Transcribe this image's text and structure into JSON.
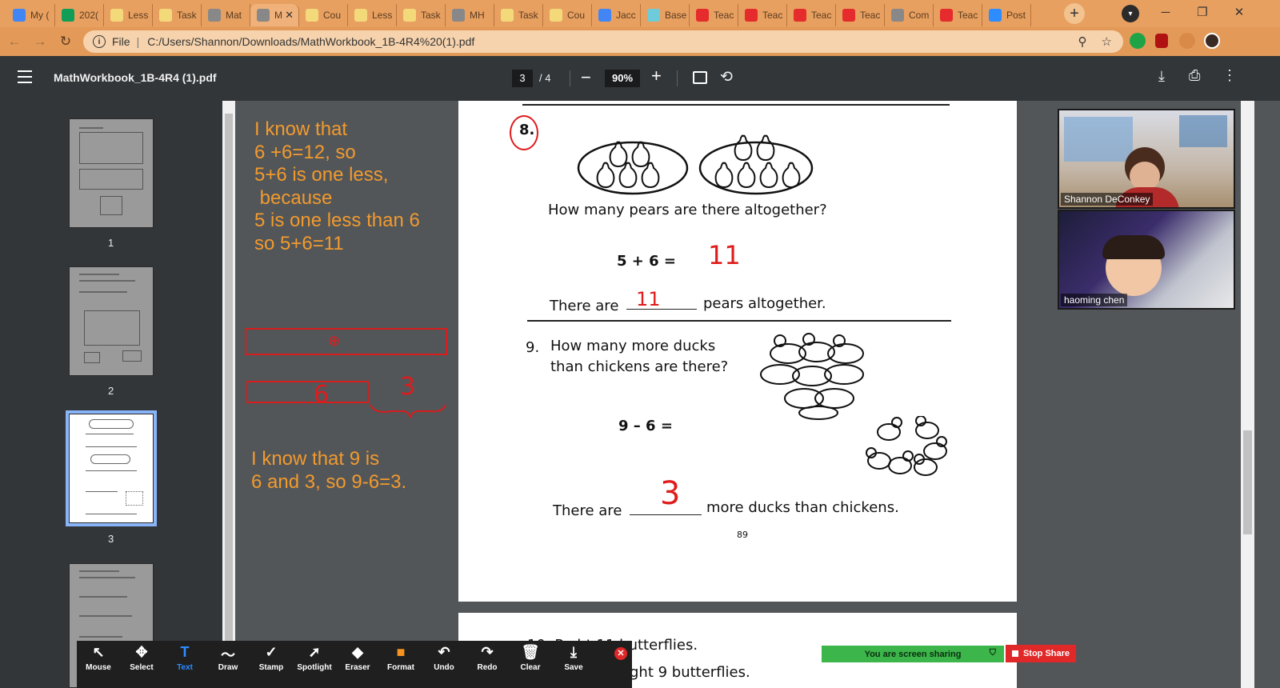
{
  "browser": {
    "tabs": [
      {
        "label": "My (",
        "fav": "#4285f4"
      },
      {
        "label": "202(",
        "fav": "#0f9d58"
      },
      {
        "label": "Less",
        "fav": "#f4d97b"
      },
      {
        "label": "Task",
        "fav": "#f4d97b"
      },
      {
        "label": "Mat",
        "fav": "#888888"
      },
      {
        "label": "M",
        "fav": "#888888",
        "active": true
      },
      {
        "label": "Cou",
        "fav": "#f4d97b"
      },
      {
        "label": "Less",
        "fav": "#f4d97b"
      },
      {
        "label": "Task",
        "fav": "#f4d97b"
      },
      {
        "label": "MH",
        "fav": "#888888"
      },
      {
        "label": "Task",
        "fav": "#f4d97b"
      },
      {
        "label": "Cou",
        "fav": "#f4d97b"
      },
      {
        "label": "Jacc",
        "fav": "#4285f4"
      },
      {
        "label": "Base",
        "fav": "#6ecbd9"
      },
      {
        "label": "Teac",
        "fav": "#e52b2b"
      },
      {
        "label": "Teac",
        "fav": "#e52b2b"
      },
      {
        "label": "Teac",
        "fav": "#e52b2b"
      },
      {
        "label": "Teac",
        "fav": "#e52b2b"
      },
      {
        "label": "Com",
        "fav": "#888888"
      },
      {
        "label": "Teac",
        "fav": "#e52b2b"
      },
      {
        "label": "Post",
        "fav": "#2d8cff"
      }
    ],
    "address": {
      "scheme_label": "File",
      "url": "C:/Users/Shannon/Downloads/MathWorkbook_1B-4R4%20(1).pdf"
    }
  },
  "pdf": {
    "title": "MathWorkbook_1B-4R4 (1).pdf",
    "current_page": "3",
    "total_pages": "/ 4",
    "zoom": "90%",
    "thumbnails": [
      "1",
      "2",
      "3"
    ]
  },
  "annotations": {
    "note1": "I know that\n6 +6=12, so\n5+6 is one less,\n because\n5 is one less than 6\nso 5+6=11",
    "note2": "I know that 9 is\n6 and 3, so 9-6=3.",
    "box1_mark": "⊕",
    "box2_mark": "6",
    "brace_mark": "3",
    "text_color": "#f29a2e",
    "ink_color": "#d61c1c"
  },
  "worksheet": {
    "q8_number": "8.",
    "q8_question": "How many pears are there altogether?",
    "q8_equation": "5  +  6  =",
    "q8_answer": "11",
    "q8_sentence_a": "There are",
    "q8_sentence_b": "pears altogether.",
    "q8_sentence_answer": "11",
    "q9_number": "9.",
    "q9_question_1": "How many more ducks",
    "q9_question_2": "than chickens are there?",
    "q9_equation": "9  –  6  =",
    "q9_sentence_a": "There are",
    "q9_sentence_b": "more ducks than chickens.",
    "q9_answer": "3",
    "page_number": "89",
    "q10_line1": "10.  P      ght 11 butterflies.",
    "q10_line2": "ght 9 butterflies."
  },
  "zoom": {
    "participants": [
      "Shannon DeConkey",
      "haoming chen"
    ],
    "toolbar": [
      {
        "label": "Mouse",
        "icon": "mouse-pointer-icon",
        "glyph": "↖"
      },
      {
        "label": "Select",
        "icon": "select-move-icon",
        "glyph": "✥"
      },
      {
        "label": "Text",
        "icon": "text-icon",
        "glyph": "T",
        "active": true
      },
      {
        "label": "Draw",
        "icon": "draw-icon",
        "glyph": "〜"
      },
      {
        "label": "Stamp",
        "icon": "stamp-icon",
        "glyph": "✓"
      },
      {
        "label": "Spotlight",
        "icon": "spotlight-icon",
        "glyph": "➚"
      },
      {
        "label": "Eraser",
        "icon": "eraser-icon",
        "glyph": "◆"
      },
      {
        "label": "Format",
        "icon": "format-icon",
        "glyph": "■"
      },
      {
        "label": "Undo",
        "icon": "undo-icon",
        "glyph": "↶"
      },
      {
        "label": "Redo",
        "icon": "redo-icon",
        "glyph": "↷"
      },
      {
        "label": "Clear",
        "icon": "trash-icon",
        "glyph": "🗑"
      },
      {
        "label": "Save",
        "icon": "save-icon",
        "glyph": "⤓"
      }
    ],
    "sharing_text": "You are screen sharing",
    "stop_share": "Stop Share"
  }
}
